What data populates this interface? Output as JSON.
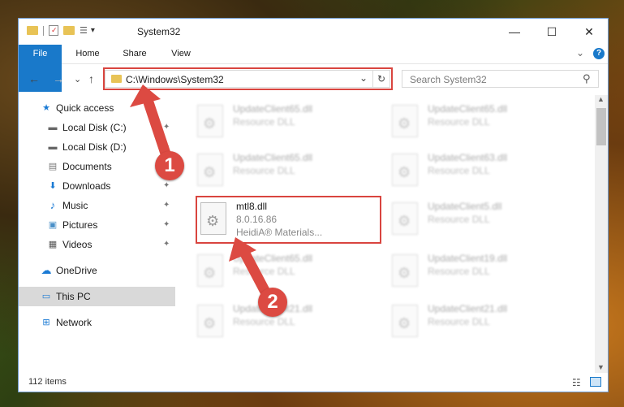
{
  "window": {
    "title": "System32",
    "controls": {
      "minimize": "—",
      "maximize": "☐",
      "close": "✕"
    }
  },
  "ribbon": {
    "tabs": [
      "File",
      "Home",
      "Share",
      "View"
    ],
    "expand_glyph": "⌄",
    "help_glyph": "?"
  },
  "nav": {
    "back": "←",
    "forward": "→",
    "recent": "⌄",
    "up": "↑",
    "address": "C:\\Windows\\System32",
    "address_dropdown": "⌄",
    "refresh": "↻",
    "search_placeholder": "Search System32",
    "search_glyph": "⚲"
  },
  "sidebar": {
    "items": [
      {
        "label": "Quick access",
        "icon": "star-icon",
        "glyph": "★",
        "pinned": false
      },
      {
        "label": "Local Disk (C:)",
        "icon": "drive-icon",
        "glyph": "▬",
        "pinned": true
      },
      {
        "label": "Local Disk (D:)",
        "icon": "drive-icon",
        "glyph": "▬",
        "pinned": true
      },
      {
        "label": "Documents",
        "icon": "documents-icon",
        "glyph": "▤",
        "pinned": true
      },
      {
        "label": "Downloads",
        "icon": "download-icon",
        "glyph": "⬇",
        "pinned": true
      },
      {
        "label": "Music",
        "icon": "music-icon",
        "glyph": "♪",
        "pinned": true
      },
      {
        "label": "Pictures",
        "icon": "pictures-icon",
        "glyph": "▣",
        "pinned": true
      },
      {
        "label": "Videos",
        "icon": "videos-icon",
        "glyph": "▦",
        "pinned": true
      },
      {
        "label": "OneDrive",
        "icon": "cloud-icon",
        "glyph": "☁",
        "pinned": false
      },
      {
        "label": "This PC",
        "icon": "computer-icon",
        "glyph": "▭",
        "pinned": false,
        "selected": true
      },
      {
        "label": "Network",
        "icon": "network-icon",
        "glyph": "⊞",
        "pinned": false
      }
    ],
    "pin_glyph": "✦"
  },
  "files": {
    "highlighted": {
      "name": "mtl8.dll",
      "version": "8.0.16.86",
      "description": "HeidiA® Materials..."
    },
    "blurred": [
      {
        "name": "UpdateClient65.dll",
        "type": "Resource DLL"
      },
      {
        "name": "UpdateClient65.dll",
        "type": "Resource DLL"
      },
      {
        "name": "UpdateClient65.dll",
        "type": "Resource DLL"
      },
      {
        "name": "UpdateClient63.dll",
        "type": "Resource DLL"
      },
      {
        "name": "UpdateClient5.dll",
        "type": "Resource DLL"
      },
      {
        "name": "UpdateClient65.dll",
        "type": "Resource DLL"
      },
      {
        "name": "UpdateClient19.dll",
        "type": "Resource DLL"
      },
      {
        "name": "UpdateClient21.dll",
        "type": "Resource DLL"
      },
      {
        "name": "UpdateClient21.dll",
        "type": "Resource DLL"
      }
    ]
  },
  "status": {
    "count": "112 items"
  },
  "markers": [
    "1",
    "2"
  ],
  "colors": {
    "accent": "#1979ca",
    "highlight": "#d9453f",
    "selection": "#d9d9d9"
  }
}
